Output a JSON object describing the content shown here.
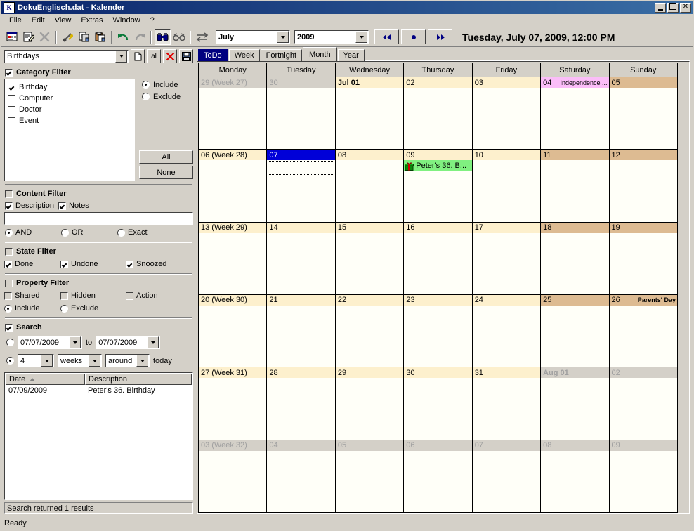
{
  "window": {
    "title": "DokuEnglisch.dat - Kalender",
    "icon": "calendar-app-icon",
    "buttons": {
      "minimize": "_",
      "maximize": "▫",
      "close": "✕"
    }
  },
  "menu": {
    "items": [
      "File",
      "Edit",
      "View",
      "Extras",
      "Window",
      "?"
    ]
  },
  "toolbar": {
    "icons": [
      {
        "name": "new-entry-icon",
        "glyph": "new"
      },
      {
        "name": "edit-entry-icon",
        "glyph": "edit"
      },
      {
        "name": "delete-entry-icon",
        "glyph": "delete"
      },
      {
        "name": "cut-icon",
        "glyph": "cut"
      },
      {
        "name": "copy-icon",
        "glyph": "copy"
      },
      {
        "name": "paste-icon",
        "glyph": "paste"
      },
      {
        "name": "undo-icon",
        "glyph": "undo"
      },
      {
        "name": "redo-icon",
        "glyph": "redo"
      },
      {
        "name": "find-icon",
        "glyph": "find"
      },
      {
        "name": "find-next-icon",
        "glyph": "findnext"
      },
      {
        "name": "sync-icon",
        "glyph": "sync"
      }
    ],
    "month_value": "July",
    "year_value": "2009",
    "nav": {
      "prev": "◀◀",
      "today": "●",
      "next": "▶▶"
    },
    "current_datetime": "Tuesday, July 07, 2009, 12:00 PM"
  },
  "filter": {
    "profile_value": "Birthdays",
    "profile_buttons": [
      {
        "name": "new-filter-button",
        "label": ""
      },
      {
        "name": "rename-filter-button",
        "label": "al"
      },
      {
        "name": "delete-filter-button",
        "label": ""
      },
      {
        "name": "save-filter-button",
        "label": ""
      }
    ],
    "category": {
      "title": "Category Filter",
      "enabled": true,
      "items": [
        {
          "label": "Birthday",
          "checked": true
        },
        {
          "label": "Computer",
          "checked": false
        },
        {
          "label": "Doctor",
          "checked": false
        },
        {
          "label": "Event",
          "checked": false
        }
      ],
      "mode_include": "Include",
      "mode_exclude": "Exclude",
      "mode_selected": "Include",
      "all_label": "All",
      "none_label": "None"
    },
    "content": {
      "title": "Content Filter",
      "enabled": false,
      "description_label": "Description",
      "description_checked": true,
      "notes_label": "Notes",
      "notes_checked": true,
      "query_value": "",
      "logic": [
        "AND",
        "OR",
        "Exact"
      ],
      "logic_selected": "AND"
    },
    "state": {
      "title": "State Filter",
      "enabled": false,
      "items": [
        {
          "label": "Done",
          "checked": true
        },
        {
          "label": "Undone",
          "checked": true
        },
        {
          "label": "Snoozed",
          "checked": true
        }
      ]
    },
    "property": {
      "title": "Property Filter",
      "enabled": false,
      "items": [
        {
          "label": "Shared",
          "checked": false
        },
        {
          "label": "Hidden",
          "checked": false
        },
        {
          "label": "Action",
          "checked": false
        }
      ],
      "mode_include": "Include",
      "mode_exclude": "Exclude",
      "mode_selected": "Include"
    },
    "search": {
      "title": "Search",
      "enabled": true,
      "range_mode_selected": false,
      "date_from": "07/07/2009",
      "to_label": "to",
      "date_to": "07/07/2009",
      "relative_mode_selected": true,
      "amount": "4",
      "unit": "weeks",
      "direction": "around",
      "anchor_label": "today"
    }
  },
  "results": {
    "columns": [
      "Date",
      "Description"
    ],
    "sort_column": "Date",
    "rows": [
      {
        "date": "07/09/2009",
        "description": "Peter's 36. Birthday"
      }
    ],
    "status": "Search returned 1 results"
  },
  "calendar": {
    "tabs": [
      {
        "label": "ToDo",
        "state": "highlighted"
      },
      {
        "label": "Week",
        "state": "normal"
      },
      {
        "label": "Fortnight",
        "state": "normal"
      },
      {
        "label": "Month",
        "state": "selected"
      },
      {
        "label": "Year",
        "state": "normal"
      }
    ],
    "day_headers": [
      "Monday",
      "Tuesday",
      "Wednesday",
      "Thursday",
      "Friday",
      "Saturday",
      "Sunday"
    ],
    "weeks": [
      {
        "days": [
          {
            "num": "29 (Week 27)",
            "type": "other"
          },
          {
            "num": "30",
            "type": "other"
          },
          {
            "num": "Jul 01",
            "type": "weekday",
            "bold": true
          },
          {
            "num": "02",
            "type": "weekday"
          },
          {
            "num": "03",
            "type": "weekday"
          },
          {
            "num": "04",
            "type": "holiday",
            "holiday": "Independence ..."
          },
          {
            "num": "05",
            "type": "weekend"
          }
        ]
      },
      {
        "days": [
          {
            "num": "06 (Week 28)",
            "type": "weekday"
          },
          {
            "num": "07",
            "type": "selected",
            "selected": true
          },
          {
            "num": "08",
            "type": "weekday"
          },
          {
            "num": "09",
            "type": "weekday",
            "events": [
              {
                "title": "Peter's 36. B...",
                "icon": "gift-icon"
              }
            ]
          },
          {
            "num": "10",
            "type": "weekday"
          },
          {
            "num": "11",
            "type": "weekend"
          },
          {
            "num": "12",
            "type": "weekend"
          }
        ]
      },
      {
        "days": [
          {
            "num": "13 (Week 29)",
            "type": "weekday"
          },
          {
            "num": "14",
            "type": "weekday"
          },
          {
            "num": "15",
            "type": "weekday"
          },
          {
            "num": "16",
            "type": "weekday"
          },
          {
            "num": "17",
            "type": "weekday"
          },
          {
            "num": "18",
            "type": "weekend"
          },
          {
            "num": "19",
            "type": "weekend"
          }
        ]
      },
      {
        "days": [
          {
            "num": "20 (Week 30)",
            "type": "weekday"
          },
          {
            "num": "21",
            "type": "weekday"
          },
          {
            "num": "22",
            "type": "weekday"
          },
          {
            "num": "23",
            "type": "weekday"
          },
          {
            "num": "24",
            "type": "weekday"
          },
          {
            "num": "25",
            "type": "weekend"
          },
          {
            "num": "26",
            "type": "weekend",
            "holiday": "Parents' Day"
          }
        ]
      },
      {
        "days": [
          {
            "num": "27 (Week 31)",
            "type": "weekday"
          },
          {
            "num": "28",
            "type": "weekday"
          },
          {
            "num": "29",
            "type": "weekday"
          },
          {
            "num": "30",
            "type": "weekday"
          },
          {
            "num": "31",
            "type": "weekday"
          },
          {
            "num": "Aug 01",
            "type": "other",
            "bold": true
          },
          {
            "num": "02",
            "type": "other"
          }
        ]
      },
      {
        "days": [
          {
            "num": "03 (Week 32)",
            "type": "other"
          },
          {
            "num": "04",
            "type": "other"
          },
          {
            "num": "05",
            "type": "other"
          },
          {
            "num": "06",
            "type": "other"
          },
          {
            "num": "07",
            "type": "other"
          },
          {
            "num": "08",
            "type": "other"
          },
          {
            "num": "09",
            "type": "other"
          }
        ]
      }
    ]
  },
  "statusbar": {
    "text": "Ready"
  },
  "colors": {
    "title_active": "#0a246a",
    "face": "#d4d0c8",
    "weekday_header": "#fdf0cd",
    "weekend_header": "#ddbb92",
    "holiday_header": "#fbbdf8",
    "selected_day": "#0000d8",
    "event_bg": "#80f080"
  }
}
